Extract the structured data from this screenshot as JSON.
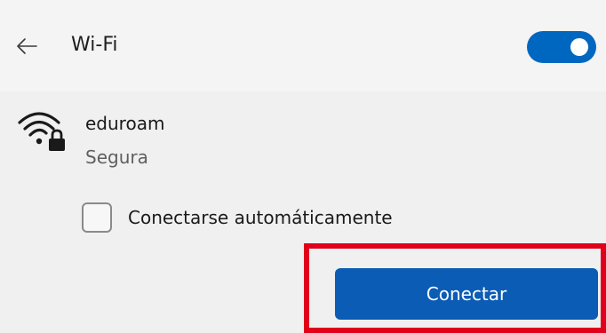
{
  "header": {
    "title": "Wi-Fi",
    "back_icon": "back-arrow-icon",
    "toggle_state": "on",
    "toggle_color": "#0067c0"
  },
  "network": {
    "name": "eduroam",
    "status": "Segura",
    "icon": "wifi-secured-icon"
  },
  "options": {
    "auto_connect_label": "Conectarse automáticamente",
    "auto_connect_checked": false
  },
  "actions": {
    "connect_label": "Conectar",
    "connect_color": "#0b5cb5",
    "highlight_color": "#e0001b"
  }
}
